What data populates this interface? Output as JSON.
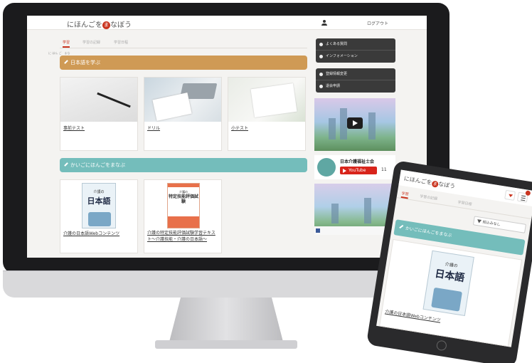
{
  "header": {
    "logo_text": "にほんごを",
    "logo_mark": "ま",
    "logo_suffix": "なぼう",
    "logout_label": "ログアウト"
  },
  "tabs": [
    "学習",
    "学習の記録",
    "学習日程"
  ],
  "sections": {
    "learn_ruby": "に ほん ご　まな",
    "learn_title": "日本語を学ぶ",
    "kaigo_title": "かいごにほんごをまなぶ"
  },
  "learn_cards": [
    {
      "label": "事前テスト"
    },
    {
      "label": "ドリル"
    },
    {
      "label": "小テスト"
    }
  ],
  "kaigo_cards": [
    {
      "label": "介護の日本語Webコンテンツ",
      "book_title": "介護の",
      "book_big": "日本語"
    },
    {
      "label": "介護の特定技能評価試験学習テキスト〜介護技能・介護の日本語〜",
      "book_line1": "介護の",
      "book_line2": "特定技能評価試験"
    }
  ],
  "sidebar": {
    "menu1": [
      "よくある質問",
      "インフォメーション"
    ],
    "menu2": [
      "登録情報変更",
      "退会申請"
    ]
  },
  "channel": {
    "name": "日本介護福祉士会",
    "youtube_label": "YouTube",
    "subscriber_count": "11"
  },
  "tablet": {
    "logo_text": "にほんごを",
    "logo_mark": "ま",
    "logo_suffix": "なぼう",
    "tabs": [
      "学習",
      "学習の記録",
      "学習日程"
    ],
    "filter_label": "絞込みなし",
    "section_title": "かいごにほんごをまなぶ",
    "book_title": "介護の",
    "book_big": "日本語",
    "card_label": "介護の日本語Webコンテンツ"
  },
  "colors": {
    "accent_red": "#c9341f",
    "band_orange": "#cf9a55",
    "band_teal": "#74bdbb",
    "youtube_red": "#d8241b"
  }
}
